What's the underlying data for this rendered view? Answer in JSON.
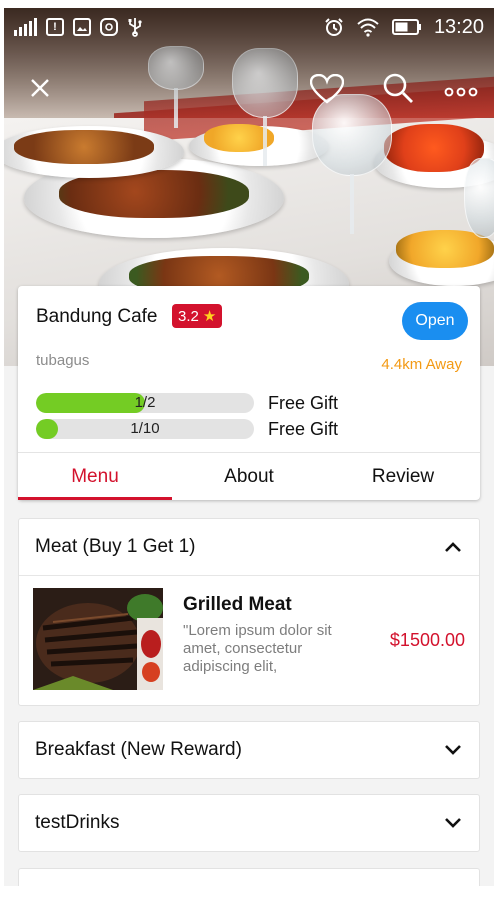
{
  "status_bar": {
    "time": "13:20",
    "notification_badge": "!"
  },
  "cafe": {
    "name": "Bandung Cafe",
    "rating": "3.2",
    "status_button": "Open",
    "owner": "tubagus",
    "distance": "4.4km Away"
  },
  "rewards": [
    {
      "progress_text": "1/2",
      "progress": 0.5,
      "label": "Free Gift"
    },
    {
      "progress_text": "1/10",
      "progress": 0.1,
      "label": "Free Gift"
    }
  ],
  "tabs": [
    {
      "label": "Menu",
      "active": true
    },
    {
      "label": "About",
      "active": false
    },
    {
      "label": "Review",
      "active": false
    }
  ],
  "sections": [
    {
      "title": "Meat (Buy 1 Get 1)",
      "expanded": true,
      "items": [
        {
          "title": "Grilled Meat",
          "description": "\"Lorem ipsum dolor sit amet, consectetur adipiscing elit,",
          "price": "$1500.00"
        }
      ]
    },
    {
      "title": "Breakfast (New Reward)",
      "expanded": false
    },
    {
      "title": "testDrinks",
      "expanded": false
    }
  ],
  "colors": {
    "accent_red": "#d3122d",
    "open_blue": "#1a8ef0",
    "progress_green": "#74cc24",
    "distance_orange": "#f39a14"
  },
  "icons": [
    "close-icon",
    "heart-icon",
    "search-icon",
    "more-icon",
    "chevron-up-icon",
    "chevron-down-icon",
    "star-icon"
  ]
}
